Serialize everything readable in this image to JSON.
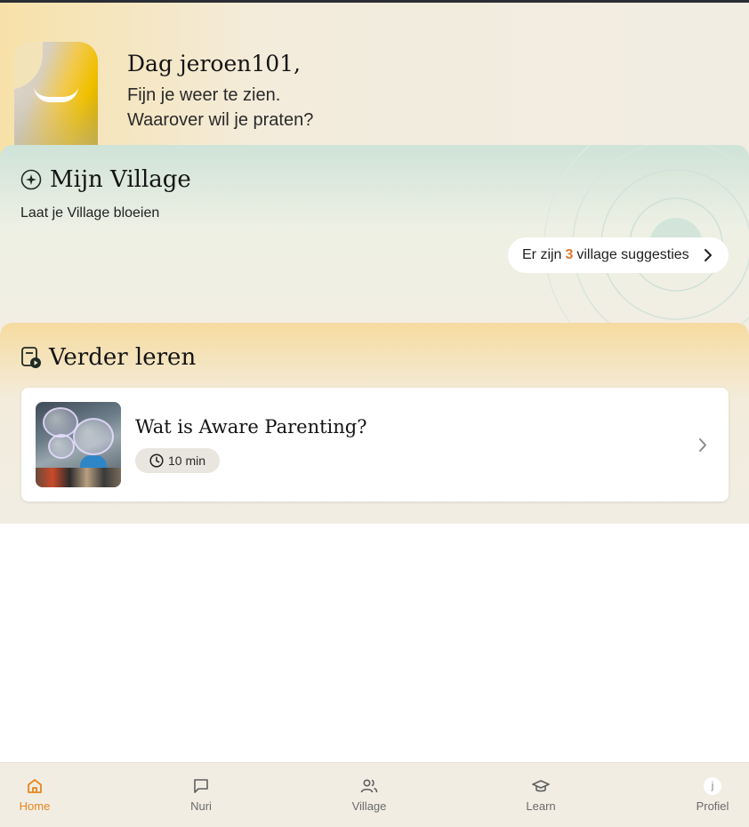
{
  "header": {
    "greeting": "Dag jeroen101,",
    "line1": "Fijn je weer te zien.",
    "line2": "Waarover wil je praten?"
  },
  "village": {
    "icon": "sparkle-icon",
    "title": "Mijn Village",
    "subtitle": "Laat je Village bloeien",
    "suggestions_prefix": "Er zijn",
    "suggestions_count": "3",
    "suggestions_suffix": "village suggesties"
  },
  "learn": {
    "icon": "video-lesson-icon",
    "title": "Verder leren",
    "course": {
      "title": "Wat is Aware Parenting?",
      "duration": "10 min"
    }
  },
  "nav": {
    "items": [
      {
        "label": "Home",
        "icon": "home-icon",
        "active": true
      },
      {
        "label": "Nuri",
        "icon": "chat-icon",
        "active": false
      },
      {
        "label": "Village",
        "icon": "users-icon",
        "active": false
      },
      {
        "label": "Learn",
        "icon": "graduation-cap-icon",
        "active": false
      },
      {
        "label": "Profiel",
        "icon": "avatar",
        "avatar_letter": "j",
        "active": false
      }
    ]
  },
  "colors": {
    "accent": "#e8861f",
    "highlight_count": "#e0782f",
    "background": "#f1ede3"
  }
}
